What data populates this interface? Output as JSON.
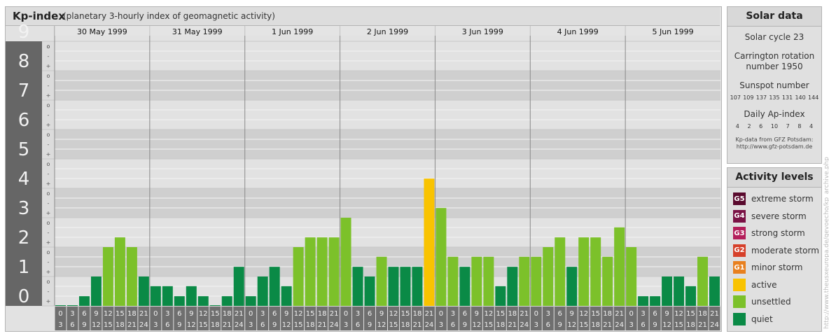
{
  "header": {
    "title": "Kp-index",
    "subtitle": "(planetary 3-hourly index of geomagnetic activity)"
  },
  "chart_data": {
    "type": "bar",
    "ylim": [
      0,
      9
    ],
    "y_major_ticks": [
      "0",
      "1",
      "2",
      "3",
      "4",
      "5",
      "6",
      "7",
      "8",
      "9"
    ],
    "y_minor_ticks": [
      "-",
      "o",
      "+"
    ],
    "days": [
      "30 May 1999",
      "31 May 1999",
      "1 Jun 1999",
      "2 Jun 1999",
      "3 Jun 1999",
      "4 Jun 1999",
      "5 Jun 1999"
    ],
    "interval_start_labels": [
      "0",
      "3",
      "6",
      "9",
      "12",
      "15",
      "18",
      "21"
    ],
    "interval_end_labels": [
      "3",
      "6",
      "9",
      "12",
      "15",
      "18",
      "21",
      "24"
    ],
    "values": [
      0,
      0,
      0.33,
      1,
      2,
      2.33,
      2,
      1,
      0.67,
      0.67,
      0.33,
      0.67,
      0.33,
      0,
      0.33,
      1.33,
      0.33,
      1,
      1.33,
      0.67,
      2,
      2.33,
      2.33,
      2.33,
      3,
      1.33,
      1,
      1.67,
      1.33,
      1.33,
      1.33,
      4.33,
      3.33,
      1.67,
      1.33,
      1.67,
      1.67,
      0.67,
      1.33,
      1.67,
      1.67,
      2,
      2.33,
      1.33,
      2.33,
      2.33,
      1.67,
      2.67,
      2,
      0.33,
      0.33,
      1,
      1,
      0.67,
      1.67,
      1
    ],
    "colors": {
      "quiet": "#0a8a46",
      "unsettled": "#7cc12a",
      "active": "#f9c300",
      "band_dark": "#cfcfcf",
      "band_light": "#e2e2e2",
      "label_col": "#666666"
    },
    "grid": true
  },
  "solar": {
    "title": "Solar data",
    "cycle": "Solar cycle 23",
    "carrington_line1": "Carrington rotation",
    "carrington_line2": "number 1950",
    "sunspot_label": "Sunspot number",
    "sunspot_values": [
      "107",
      "109",
      "137",
      "135",
      "131",
      "140",
      "144"
    ],
    "ap_label": "Daily Ap-index",
    "ap_values": [
      "4",
      "2",
      "6",
      "10",
      "7",
      "8",
      "4"
    ],
    "credit_line1": "Kp-data from GFZ Potsdam:",
    "credit_line2": "http://www.gfz-potsdam.de"
  },
  "activity": {
    "title": "Activity levels",
    "levels": [
      {
        "badge": "G5",
        "label": "extreme storm",
        "color": "#5a0a2e"
      },
      {
        "badge": "G4",
        "label": "severe storm",
        "color": "#7a1245"
      },
      {
        "badge": "G3",
        "label": "strong storm",
        "color": "#b31e5a"
      },
      {
        "badge": "G2",
        "label": "moderate storm",
        "color": "#d6402a"
      },
      {
        "badge": "G1",
        "label": "minor storm",
        "color": "#e8801f"
      },
      {
        "badge": "",
        "label": "active",
        "color": "#f9c300"
      },
      {
        "badge": "",
        "label": "unsettled",
        "color": "#7cc12a"
      },
      {
        "badge": "",
        "label": "quiet",
        "color": "#0a8a46"
      }
    ]
  },
  "watermark": "http://www.theusxeuropa.de/gevoecho/kp_archive.php"
}
